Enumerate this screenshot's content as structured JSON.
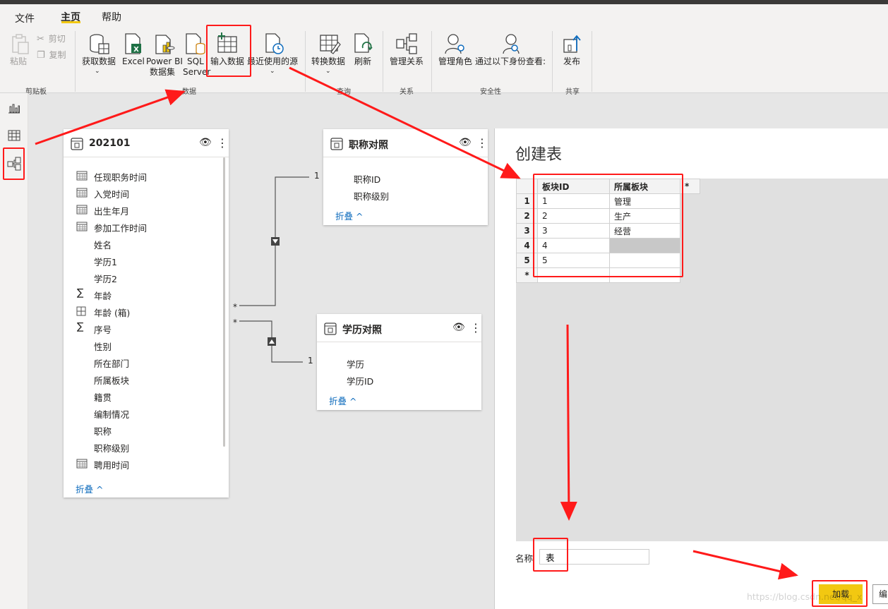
{
  "ribbon_tabs": [
    "文件",
    "主页",
    "帮助"
  ],
  "clipboard": {
    "paste": "粘贴",
    "cut": "剪切",
    "copy": "复制",
    "label": "剪贴板"
  },
  "data_group": {
    "get_data": "获取数据",
    "excel": "Excel",
    "powerbi_1": "Power BI",
    "powerbi_2": "数据集",
    "sql_1": "SQL",
    "sql_2": "Server",
    "enter_data": "输入数据",
    "recent_sources": "最近使用的源",
    "label": "数据"
  },
  "query_group": {
    "transform": "转换数据",
    "refresh": "刷新",
    "label": "查询"
  },
  "relations_group": {
    "manage": "管理关系",
    "label": "关系"
  },
  "security_group": {
    "manage_roles": "管理角色",
    "view_as": "通过以下身份查看:",
    "label": "安全性"
  },
  "share_group": {
    "publish": "发布",
    "label": "共享"
  },
  "tables": {
    "t202101": {
      "title": "202101",
      "fields": [
        "任现职务时间",
        "入党时间",
        "出生年月",
        "参加工作时间",
        "姓名",
        "学历1",
        "学历2",
        "年龄",
        "年龄 (箱)",
        "序号",
        "性别",
        "所在部门",
        "所属板块",
        "籍贯",
        "编制情况",
        "职称",
        "职称级别",
        "聘用时间"
      ],
      "collapse": "折叠 ^"
    },
    "title_map": {
      "title": "职称对照",
      "fields": [
        "职称ID",
        "职称级别"
      ],
      "collapse": "折叠 ^"
    },
    "edu_map": {
      "title": "学历对照",
      "fields": [
        "学历",
        "学历ID"
      ],
      "collapse": "折叠 ^"
    }
  },
  "relations": {
    "one": "1",
    "many": "*"
  },
  "dialog": {
    "title": "创建表",
    "columns": [
      "板块ID",
      "所属板块",
      "*"
    ],
    "rows": [
      {
        "n": "1",
        "id": "1",
        "sector": "管理"
      },
      {
        "n": "2",
        "id": "2",
        "sector": "生产"
      },
      {
        "n": "3",
        "id": "3",
        "sector": "经营"
      },
      {
        "n": "4",
        "id": "4",
        "sector": ""
      },
      {
        "n": "5",
        "id": "5",
        "sector": ""
      },
      {
        "n": "*",
        "id": "",
        "sector": ""
      }
    ],
    "name_label": "名称",
    "name_value": "表",
    "load_button": "加载",
    "edit_button": "编",
    "watermark": "https://blog.csdn.net/qq_x"
  },
  "colors": {
    "accent": "#f2c811",
    "annotation": "#ff1a1a",
    "link": "#0f6cbd"
  }
}
